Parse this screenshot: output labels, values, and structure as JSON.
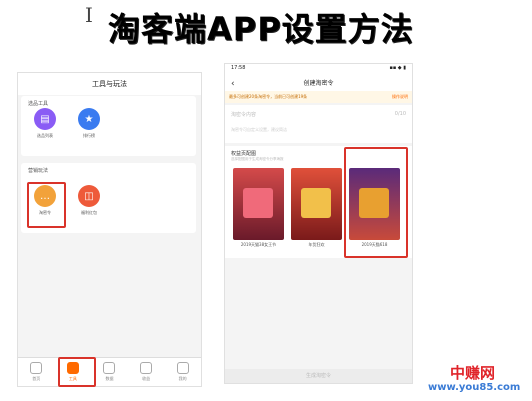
{
  "cursor_glyph": "I",
  "title": "淘客端APP设置方法",
  "left_phone": {
    "header": "工具与玩法",
    "card1": {
      "title": "选品工具",
      "tools": [
        {
          "label": "选品列表",
          "icon": "list-icon",
          "color": "#8a5cf5"
        },
        {
          "label": "排行榜",
          "icon": "star-icon",
          "color": "#3a7bf0"
        }
      ]
    },
    "card2": {
      "title": "营销玩法",
      "tools": [
        {
          "label": "淘密令",
          "icon": "chat-icon",
          "color": "#f2a23a"
        },
        {
          "label": "福利红包",
          "icon": "gift-icon",
          "color": "#ee5a3a"
        }
      ]
    },
    "tabs": [
      "首页",
      "工具",
      "数据",
      "收益",
      "我的"
    ]
  },
  "right_phone": {
    "time": "17:58",
    "signal": "▪▪ ◆ ▮",
    "nav_title": "创建淘密令",
    "back_icon": "‹",
    "notice": "最多可创建20条淘密令，当前已可创建19条",
    "notice_action": "操作说明",
    "input_label": "淘密令内容",
    "input_count": "0/10",
    "input_tip": "淘密令可自定义设置，建议简洁",
    "poster_title": "权益页配图",
    "poster_sub": "选择配图用于生成淘密令分享海报",
    "posters": [
      {
        "label": "2019天猫38女王节",
        "bg": "#b03a3a"
      },
      {
        "label": "年货狂欢",
        "bg": "#c0392b"
      },
      {
        "label": "2019天猫618",
        "bg": "#7a3a8a"
      }
    ],
    "bottom_button": "生成淘密令"
  },
  "watermark": {
    "brand": "中赚网",
    "url": "www.you85.com"
  }
}
